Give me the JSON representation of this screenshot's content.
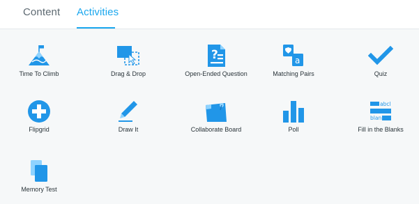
{
  "tabs": {
    "content": "Content",
    "activities": "Activities"
  },
  "colors": {
    "accent": "#1aa7ee",
    "icon_blue": "#2196e8"
  },
  "activities": [
    {
      "label": "Time To Climb",
      "icon": "mountain-flag-icon"
    },
    {
      "label": "Drag & Drop",
      "icon": "drag-drop-icon"
    },
    {
      "label": "Open-Ended Question",
      "icon": "question-document-icon"
    },
    {
      "label": "Matching Pairs",
      "icon": "matching-pairs-icon"
    },
    {
      "label": "Quiz",
      "icon": "checkmark-icon"
    },
    {
      "label": "Flipgrid",
      "icon": "plus-circle-icon"
    },
    {
      "label": "Draw It",
      "icon": "pencil-icon"
    },
    {
      "label": "Collaborate Board",
      "icon": "pinned-board-icon"
    },
    {
      "label": "Poll",
      "icon": "bar-chart-icon"
    },
    {
      "label": "Fill in the Blanks",
      "icon": "fill-blanks-icon"
    },
    {
      "label": "Memory Test",
      "icon": "memory-cards-icon"
    }
  ],
  "fill_blanks_icon_text": {
    "top": "abcl",
    "bottom": "blan"
  }
}
